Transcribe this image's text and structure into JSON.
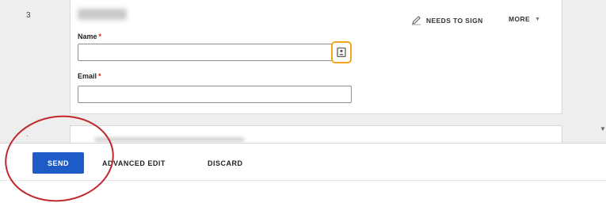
{
  "recipient": {
    "step_number": "3",
    "actions": {
      "needs_to_sign": "NEEDS TO SIGN",
      "more": "MORE",
      "more_chevron": "▼"
    },
    "fields": {
      "name": {
        "label": "Name",
        "required_mark": "*",
        "value": "",
        "icon": "contact-card-icon"
      },
      "email": {
        "label": "Email",
        "required_mark": "*",
        "value": ""
      }
    }
  },
  "footer": {
    "send_label": "SEND",
    "advanced_edit_label": "ADVANCED EDIT",
    "discard_label": "DISCARD"
  },
  "colors": {
    "primary": "#1e5bc6",
    "highlight_orange": "#f4a51c",
    "annotation_red": "#c0282d",
    "required_red": "#d21f1f"
  }
}
